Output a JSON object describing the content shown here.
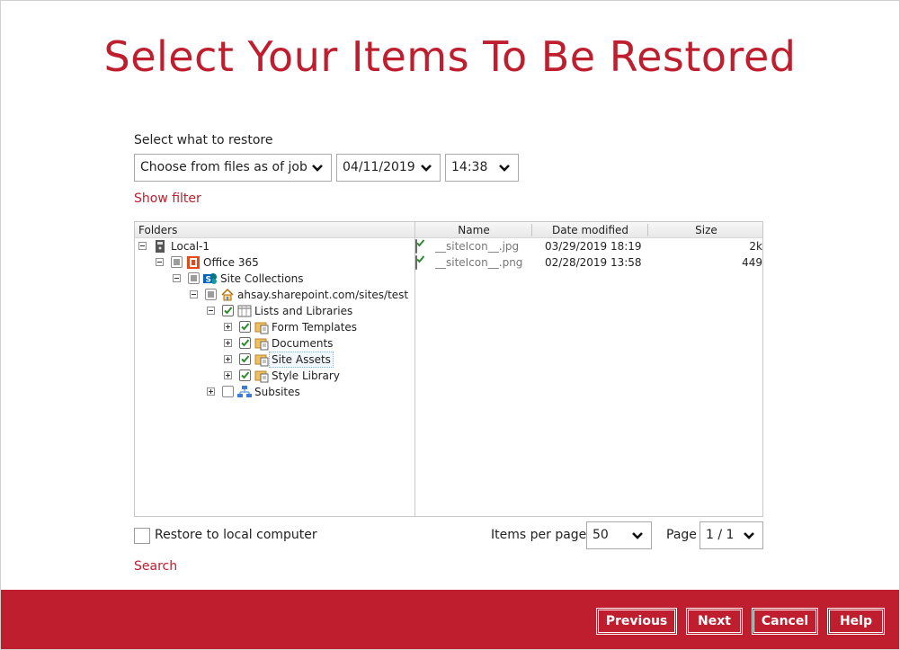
{
  "title": "Select Your Items To Be Restored",
  "restore": {
    "label": "Select what to restore",
    "mode": "Choose from files as of job",
    "date": "04/11/2019",
    "time": "14:38"
  },
  "show_filter": "Show filter",
  "tree": {
    "header": "Folders",
    "nodes": [
      {
        "label": "Local-1",
        "icon": "drive-icon",
        "check": "none"
      },
      {
        "label": "Office 365",
        "icon": "office365-icon",
        "check": "partial"
      },
      {
        "label": "Site Collections",
        "icon": "sharepoint-icon",
        "check": "partial"
      },
      {
        "label": "ahsay.sharepoint.com/sites/test",
        "icon": "home-icon",
        "check": "partial"
      },
      {
        "label": "Lists and Libraries",
        "icon": "table-icon",
        "check": "checked"
      },
      {
        "label": "Form Templates",
        "icon": "library-folder-icon",
        "check": "checked"
      },
      {
        "label": "Documents",
        "icon": "library-folder-icon",
        "check": "checked"
      },
      {
        "label": "Site Assets",
        "icon": "library-folder-icon",
        "check": "checked"
      },
      {
        "label": "Style Library",
        "icon": "library-folder-icon",
        "check": "checked"
      },
      {
        "label": "Subsites",
        "icon": "sitemap-icon",
        "check": "unchecked"
      }
    ]
  },
  "files": {
    "columns": [
      "Name",
      "Date modified",
      "Size"
    ],
    "rows": [
      {
        "name": "__siteIcon__.jpg",
        "date": "03/29/2019 18:19",
        "size": "2k"
      },
      {
        "name": "__siteIcon__.png",
        "date": "02/28/2019 13:58",
        "size": "449"
      }
    ]
  },
  "restore_local": "Restore to local computer",
  "pagination": {
    "items_label": "Items per page",
    "items_value": "50",
    "page_label": "Page",
    "page_value": "1 / 1"
  },
  "search": "Search",
  "buttons": {
    "previous": "Previous",
    "next": "Next",
    "cancel": "Cancel",
    "help": "Help"
  },
  "colors": {
    "brand": "#be1e2d",
    "check": "#2e8b2e"
  }
}
